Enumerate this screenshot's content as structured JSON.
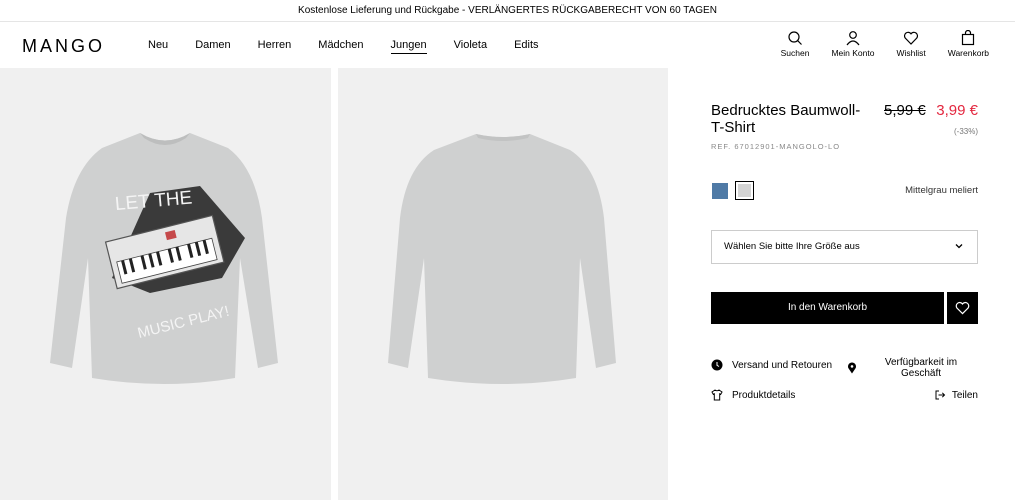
{
  "promo": "Kostenlose Lieferung und Rückgabe - VERLÄNGERTES RÜCKGABERECHT VON 60 TAGEN",
  "logo": "MANGO",
  "nav": [
    "Neu",
    "Damen",
    "Herren",
    "Mädchen",
    "Jungen",
    "Violeta",
    "Edits"
  ],
  "nav_active": "Jungen",
  "tools": {
    "search": "Suchen",
    "account": "Mein Konto",
    "wishlist": "Wishlist",
    "cart": "Warenkorb"
  },
  "product": {
    "title": "Bedrucktes Baumwoll-T-Shirt",
    "old_price": "5,99 €",
    "new_price": "3,99 €",
    "discount": "(-33%)",
    "ref": "REF. 67012901-MANGOLO-LO",
    "color_name": "Mittelgrau meliert",
    "swatches": [
      "#4f7aa6",
      "#d4d4d4"
    ],
    "print_text_1": "LET THE",
    "print_text_2": "MUSIC PLAY!"
  },
  "size_select": {
    "placeholder": "Wählen Sie bitte Ihre Größe aus"
  },
  "actions": {
    "add_to_cart": "In den Warenkorb",
    "shipping": "Versand und Retouren",
    "availability": "Verfügbarkeit im Geschäft",
    "details": "Produktdetails",
    "share": "Teilen"
  },
  "colors": {
    "price_red": "#e3273f",
    "image_bg": "#f0f0f0"
  }
}
